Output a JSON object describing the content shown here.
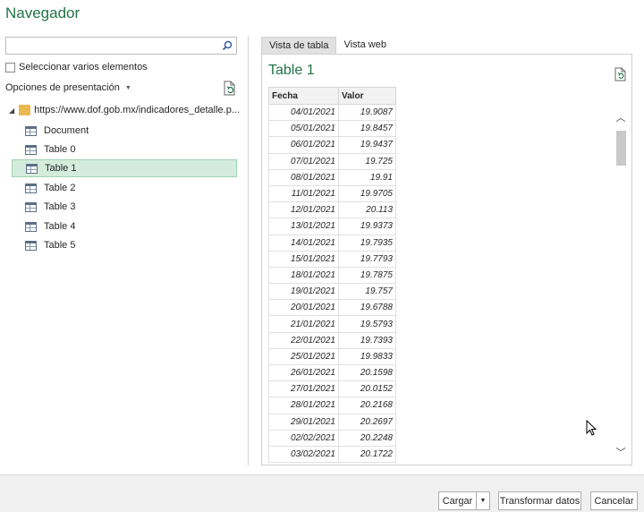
{
  "window": {
    "title": "Navegador"
  },
  "search": {
    "placeholder": "",
    "value": ""
  },
  "options": {
    "multi_select_label": "Seleccionar varios elementos",
    "display_options_label": "Opciones de presentación"
  },
  "tree": {
    "root_label": "https://www.dof.gob.mx/indicadores_detalle.p...",
    "items": [
      {
        "label": "Document"
      },
      {
        "label": "Table 0"
      },
      {
        "label": "Table 1"
      },
      {
        "label": "Table 2"
      },
      {
        "label": "Table 3"
      },
      {
        "label": "Table 4"
      },
      {
        "label": "Table 5"
      }
    ],
    "selected": "Table 1"
  },
  "tabs": {
    "table_view": "Vista de tabla",
    "web_view": "Vista web"
  },
  "preview": {
    "title": "Table 1",
    "columns": [
      "Fecha",
      "Valor"
    ],
    "rows": [
      [
        "04/01/2021",
        "19.9087"
      ],
      [
        "05/01/2021",
        "19.8457"
      ],
      [
        "06/01/2021",
        "19.9437"
      ],
      [
        "07/01/2021",
        "19.725"
      ],
      [
        "08/01/2021",
        "19.91"
      ],
      [
        "11/01/2021",
        "19.9705"
      ],
      [
        "12/01/2021",
        "20.113"
      ],
      [
        "13/01/2021",
        "19.9373"
      ],
      [
        "14/01/2021",
        "19.7935"
      ],
      [
        "15/01/2021",
        "19.7793"
      ],
      [
        "18/01/2021",
        "19.7875"
      ],
      [
        "19/01/2021",
        "19.757"
      ],
      [
        "20/01/2021",
        "19.6788"
      ],
      [
        "21/01/2021",
        "19.5793"
      ],
      [
        "22/01/2021",
        "19.7393"
      ],
      [
        "25/01/2021",
        "19.9833"
      ],
      [
        "26/01/2021",
        "20.1598"
      ],
      [
        "27/01/2021",
        "20.0152"
      ],
      [
        "28/01/2021",
        "20.2168"
      ],
      [
        "29/01/2021",
        "20.2697"
      ],
      [
        "02/02/2021",
        "20.2248"
      ],
      [
        "03/02/2021",
        "20.1722"
      ]
    ]
  },
  "footer": {
    "load_label": "Cargar",
    "transform_label": "Transformar datos",
    "cancel_label": "Cancelar"
  },
  "colors": {
    "accent": "#217346",
    "selected_bg": "#d4ecdc"
  }
}
